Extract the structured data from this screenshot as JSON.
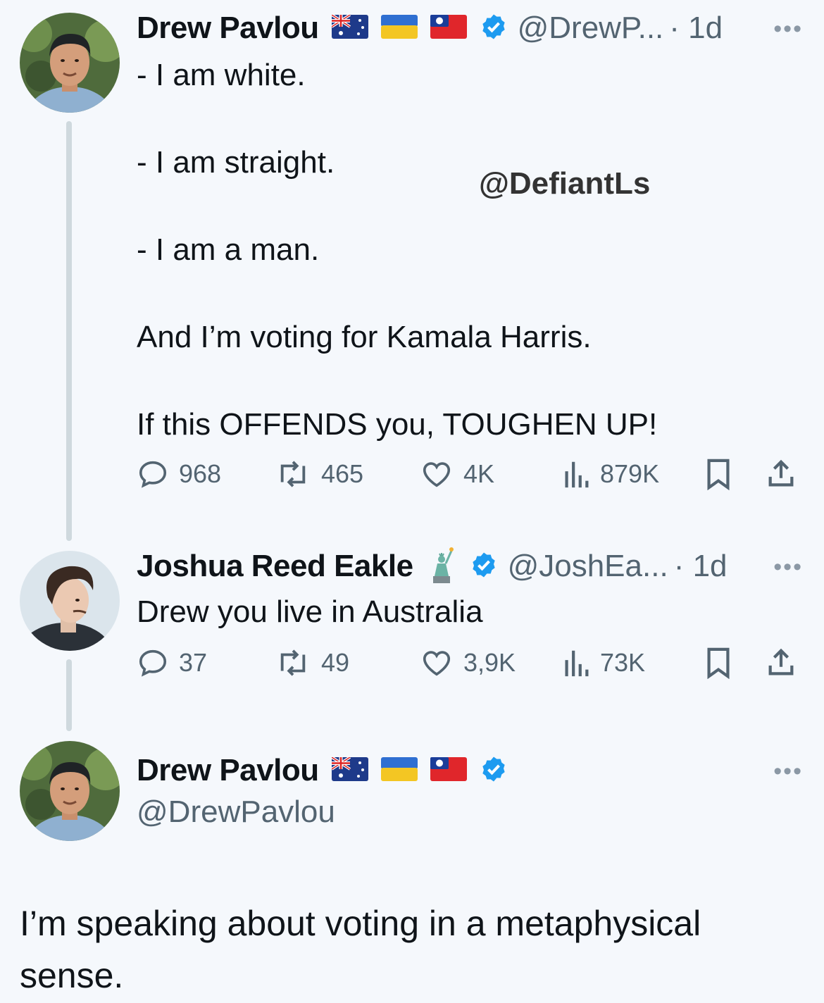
{
  "tweet1": {
    "name": "Drew Pavlou",
    "handle": "@DrewP...",
    "time": "· 1d",
    "text": "- I am white.\n\n- I am straight.\n\n- I am a man.\n\nAnd I’m voting for Kamala Harris.\n\nIf this OFFENDS you, TOUGHEN UP!",
    "replies": "968",
    "reposts": "465",
    "likes": "4K",
    "views": "879K"
  },
  "watermark": "@DefiantLs",
  "tweet2": {
    "name": "Joshua Reed Eakle",
    "handle": "@JoshEa...",
    "time": "· 1d",
    "text": "Drew you live in Australia",
    "replies": "37",
    "reposts": "49",
    "likes": "3,9K",
    "views": "73K"
  },
  "tweet3": {
    "name": "Drew Pavlou",
    "handle": "@DrewPavlou",
    "text": "I’m speaking about voting in a metaphysical sense."
  },
  "colors": {
    "verified": "#1d9bf0",
    "muted": "#536471",
    "background": "#f5f8fc"
  },
  "icons": [
    "reply-icon",
    "repost-icon",
    "like-icon",
    "views-icon",
    "bookmark-icon",
    "share-icon",
    "verified-badge-icon",
    "more-icon"
  ]
}
